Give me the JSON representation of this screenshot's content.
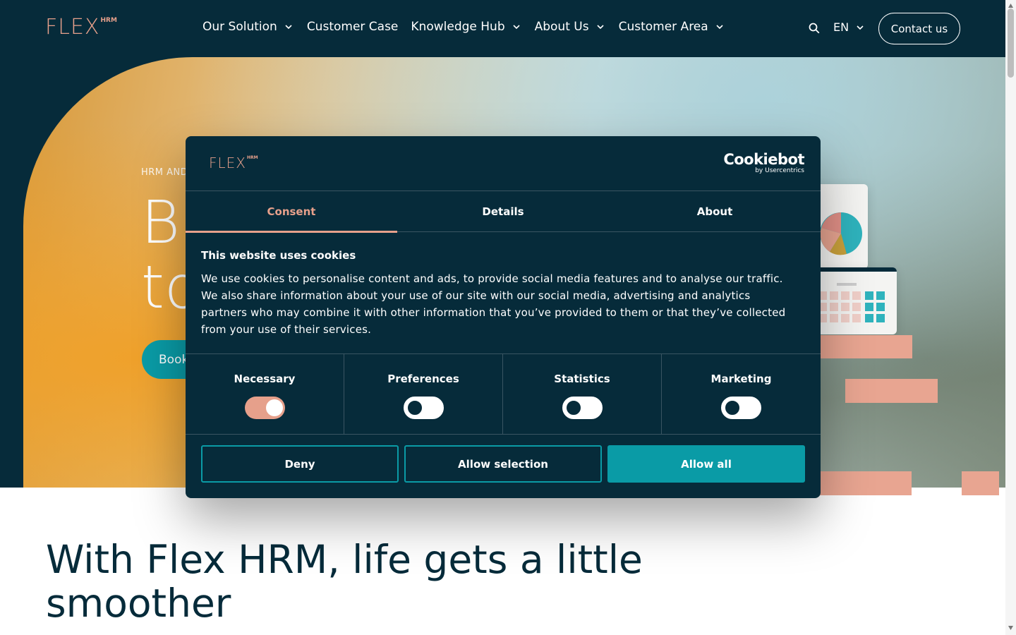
{
  "brand": {
    "logo_text": "FLEX",
    "logo_sup": "HRM",
    "accent": "#e6a08b",
    "navy": "#062b3a",
    "teal": "#0a9ba6"
  },
  "nav": {
    "items": [
      {
        "label": "Our Solution",
        "has_menu": true
      },
      {
        "label": "Customer Case",
        "has_menu": false
      },
      {
        "label": "Knowledge Hub",
        "has_menu": true
      },
      {
        "label": "About Us",
        "has_menu": true
      },
      {
        "label": "Customer Area",
        "has_menu": true
      }
    ],
    "language": "EN",
    "contact_label": "Contact us"
  },
  "hero": {
    "eyebrow": "HRM AND",
    "title_line1": "B",
    "title_line2": "to",
    "cta_label": "Book"
  },
  "cookie": {
    "provider_main": "Cookiebot",
    "provider_sub": "by Usercentrics",
    "tabs": [
      {
        "label": "Consent",
        "active": true
      },
      {
        "label": "Details",
        "active": false
      },
      {
        "label": "About",
        "active": false
      }
    ],
    "title": "This website uses cookies",
    "body": "We use cookies to personalise content and ads, to provide social media features and to analyse our traffic. We also share information about your use of our site with our social media, advertising and analytics partners who may combine it with other information that you’ve provided to them or that they’ve collected from your use of their services.",
    "categories": [
      {
        "label": "Necessary",
        "enabled": true
      },
      {
        "label": "Preferences",
        "enabled": false
      },
      {
        "label": "Statistics",
        "enabled": false
      },
      {
        "label": "Marketing",
        "enabled": false
      }
    ],
    "buttons": {
      "deny": "Deny",
      "allow_selection": "Allow selection",
      "allow_all": "Allow all"
    }
  },
  "headline": "With Flex HRM, life gets a little smoother"
}
